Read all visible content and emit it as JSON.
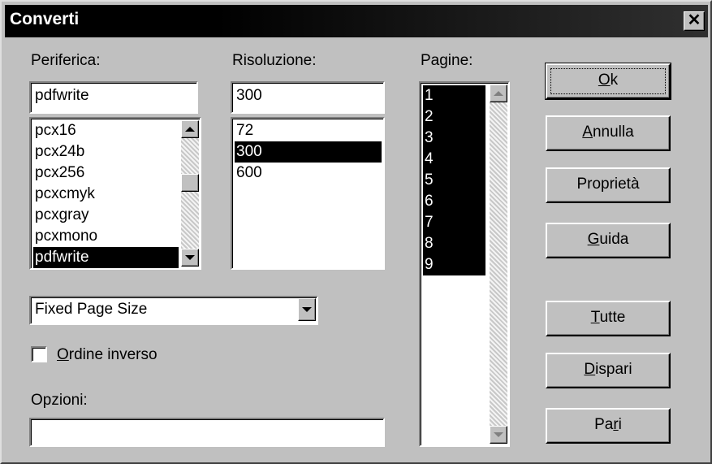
{
  "window": {
    "title": "Converti",
    "close_symbol": "✕"
  },
  "device": {
    "label": "Periferica:",
    "value": "pdfwrite",
    "items": [
      "pcx16",
      "pcx24b",
      "pcx256",
      "pcxcmyk",
      "pcxgray",
      "pcxmono",
      "pdfwrite"
    ],
    "selected": "pdfwrite"
  },
  "resolution": {
    "label": "Risoluzione:",
    "value": "300",
    "items": [
      "72",
      "300",
      "600"
    ],
    "selected": "300"
  },
  "pages": {
    "label": "Pagine:",
    "items": [
      "1",
      "2",
      "3",
      "4",
      "5",
      "6",
      "7",
      "8",
      "9"
    ]
  },
  "page_size": {
    "value": "Fixed Page Size"
  },
  "reverse_order": {
    "label_underlined": "O",
    "label_rest": "rdine inverso",
    "checked": false
  },
  "options": {
    "label": "Opzioni:",
    "value": ""
  },
  "buttons": {
    "ok": {
      "u": "O",
      "rest": "k"
    },
    "cancel": {
      "u": "A",
      "rest": "nnulla"
    },
    "properties": {
      "text": "Proprietà"
    },
    "help": {
      "u": "G",
      "rest": "uida"
    },
    "all": {
      "u": "T",
      "rest": "utte"
    },
    "odd": {
      "u": "D",
      "rest": "ispari"
    },
    "even": {
      "pre": "Pa",
      "u": "r",
      "rest": "i"
    }
  },
  "icons": {
    "close": "close-icon",
    "scroll_up": "arrow-up-icon",
    "scroll_down": "arrow-down-icon",
    "dropdown": "chevron-down-icon"
  }
}
